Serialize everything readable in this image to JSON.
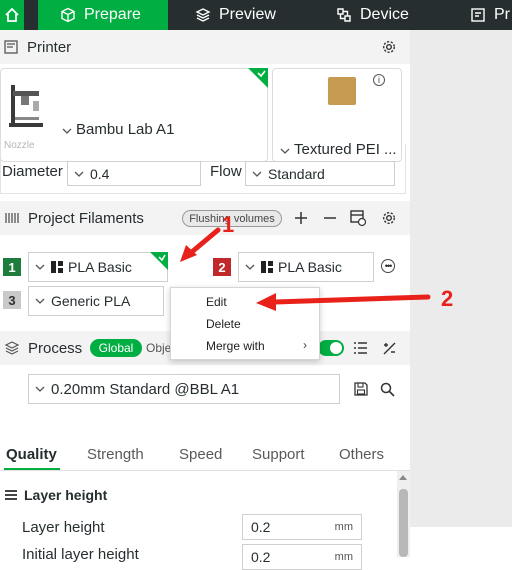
{
  "topbar": {
    "tabs": [
      {
        "label": "Prepare"
      },
      {
        "label": "Preview"
      },
      {
        "label": "Device"
      },
      {
        "label": "Pr"
      }
    ]
  },
  "printer": {
    "title": "Printer",
    "model": "Bambu Lab A1",
    "plate": "Textured PEI ...",
    "nozzle_label": "Nozzle",
    "diameter_label": "Diameter",
    "diameter_value": "0.4",
    "flow_label": "Flow",
    "flow_value": "Standard"
  },
  "filaments": {
    "title": "Project Filaments",
    "flushing_label": "Flushing volumes",
    "items": [
      {
        "num": "1",
        "name": "PLA Basic",
        "color": "#1e7d3c"
      },
      {
        "num": "2",
        "name": "PLA Basic",
        "color": "#c0282a"
      },
      {
        "num": "3",
        "name": "Generic PLA",
        "color": "#c9c9c9"
      }
    ]
  },
  "context_menu": {
    "items": [
      {
        "label": "Edit"
      },
      {
        "label": "Delete"
      },
      {
        "label": "Merge with"
      }
    ]
  },
  "process": {
    "title": "Process",
    "global_label": "Global",
    "objects_label": "Obje",
    "preset": "0.20mm Standard @BBL A1",
    "tabs": [
      "Quality",
      "Strength",
      "Speed",
      "Support",
      "Others"
    ],
    "group_title": "Layer height",
    "params": [
      {
        "label": "Layer height",
        "value": "0.2",
        "unit": "mm"
      },
      {
        "label": "Initial layer height",
        "value": "0.2",
        "unit": "mm"
      }
    ]
  },
  "annotations": {
    "arrow1_label": "1",
    "arrow2_label": "2"
  },
  "colors": {
    "accent": "#00ae42",
    "topbar": "#262e30",
    "annotation": "#e8221b"
  }
}
